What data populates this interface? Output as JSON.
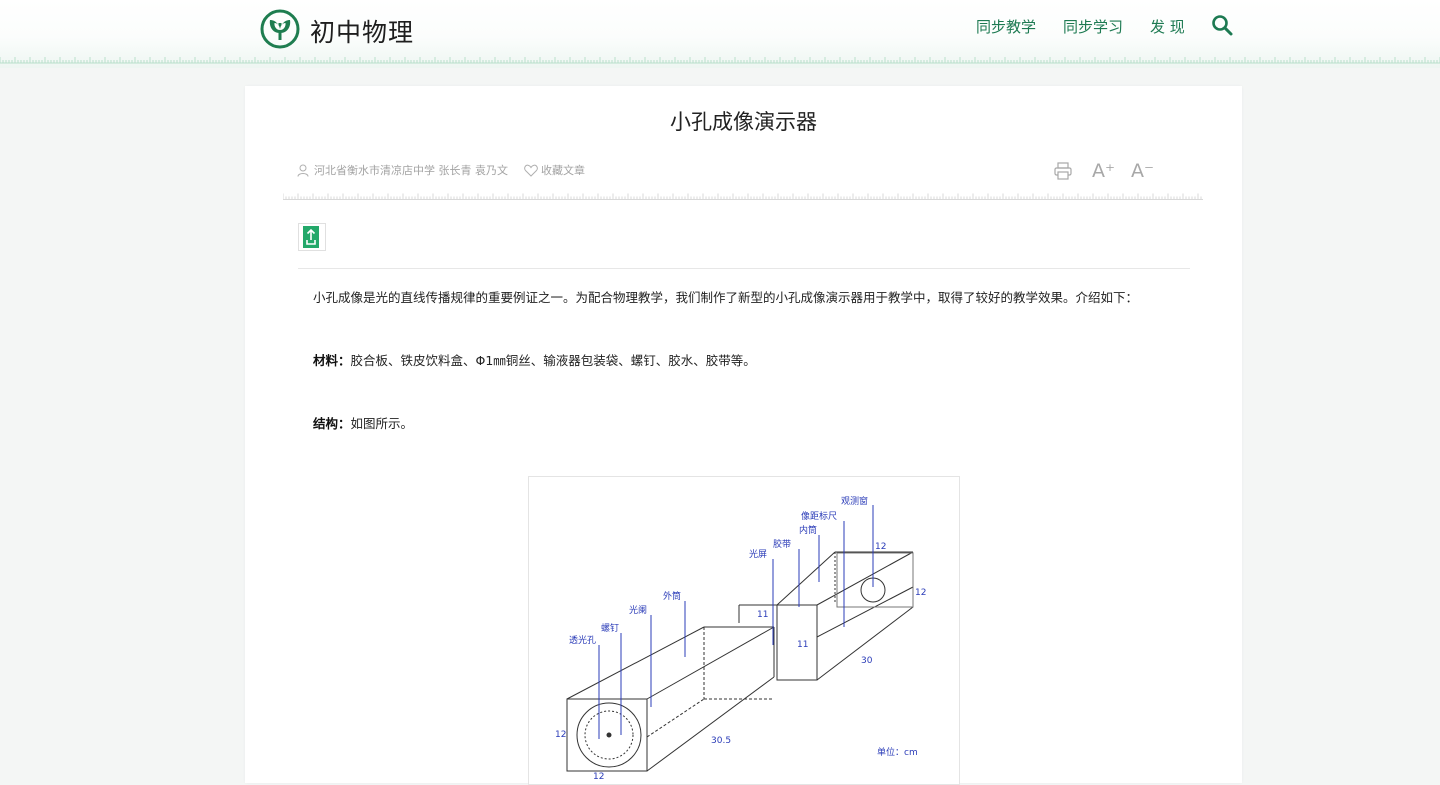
{
  "header": {
    "site_title": "初中物理",
    "nav": [
      "同步教学",
      "同步学习",
      "发 现"
    ],
    "brand_color": "#1d7a52"
  },
  "article": {
    "title": "小孔成像演示器",
    "author": "河北省衡水市清凉店中学 张长青 袁乃文",
    "favorite_label": "收藏文章",
    "font_increase": "A⁺",
    "font_decrease": "A⁻",
    "intro": "小孔成像是光的直线传播规律的重要例证之一。为配合物理教学，我们制作了新型的小孔成像演示器用于教学中，取得了较好的教学效果。介绍如下：",
    "materials_label": "材料：",
    "materials_text": "胶合板、铁皮饮料盒、Φ1㎜铜丝、输液器包装袋、螺钉、胶水、胶带等。",
    "structure_label": "结构：",
    "structure_text": "如图所示。"
  },
  "figure": {
    "labels": {
      "observe_window": "观测窗",
      "image_scale": "像距标尺",
      "inner_tube": "内筒",
      "tape": "胶带",
      "screen": "光屏",
      "outer_tube": "外筒",
      "aperture": "光阑",
      "screw": "螺钉",
      "pinhole": "透光孔"
    },
    "dims": {
      "d12_top": "12",
      "d12_right": "12",
      "d11_a": "11",
      "d11_b": "11",
      "d30": "30",
      "d30_5": "30.5",
      "d12_left": "12",
      "d12_bottom": "12"
    },
    "unit_label": "单位：cm"
  }
}
